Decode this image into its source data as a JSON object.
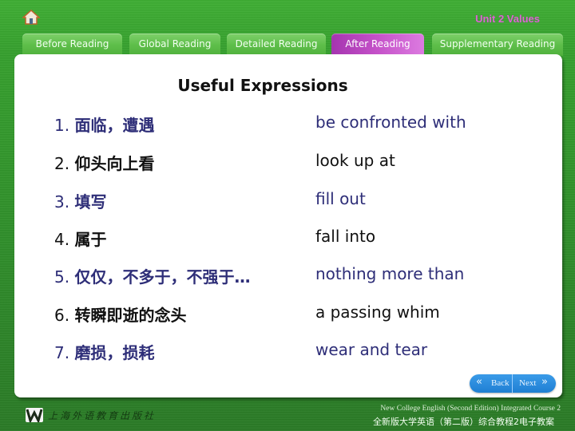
{
  "header": {
    "home_icon": "home-icon",
    "unit_title": "Unit 2  Values"
  },
  "tabs": [
    {
      "label": "Before Reading",
      "active": false
    },
    {
      "label": "Global Reading",
      "active": false
    },
    {
      "label": "Detailed Reading",
      "active": false
    },
    {
      "label": "After Reading",
      "active": true
    },
    {
      "label": "Supplementary Reading",
      "active": false
    }
  ],
  "main": {
    "title": "Useful Expressions",
    "expressions": [
      {
        "num": "1.",
        "chinese": "面临，遭遇",
        "english": "be confronted with",
        "color": "#2e2e78"
      },
      {
        "num": "2.",
        "chinese": "仰头向上看",
        "english": "look up at",
        "color": "#111111"
      },
      {
        "num": "3.",
        "chinese": "填写",
        "english": "fill out",
        "color": "#2e2e78"
      },
      {
        "num": "4.",
        "chinese": "属于",
        "english": "fall into",
        "color": "#111111"
      },
      {
        "num": "5.",
        "chinese": "仅仅，不多于，不强于…",
        "english": "nothing more than",
        "color": "#2e2e78"
      },
      {
        "num": "6.",
        "chinese": "转瞬即逝的念头",
        "english": "a passing whim",
        "color": "#111111"
      },
      {
        "num": "7.",
        "chinese": "磨损，损耗",
        "english": "wear and tear",
        "color": "#2e2e78"
      }
    ]
  },
  "nav": {
    "back_label": "Back",
    "next_label": "Next",
    "back_icon": "«",
    "next_icon": "»"
  },
  "footer": {
    "publisher": "上海外语教育出版社",
    "course_en": "New College English (Second Edition) Integrated Course 2",
    "course_cn": "全新版大学英语（第二版）综合教程2电子教案"
  }
}
